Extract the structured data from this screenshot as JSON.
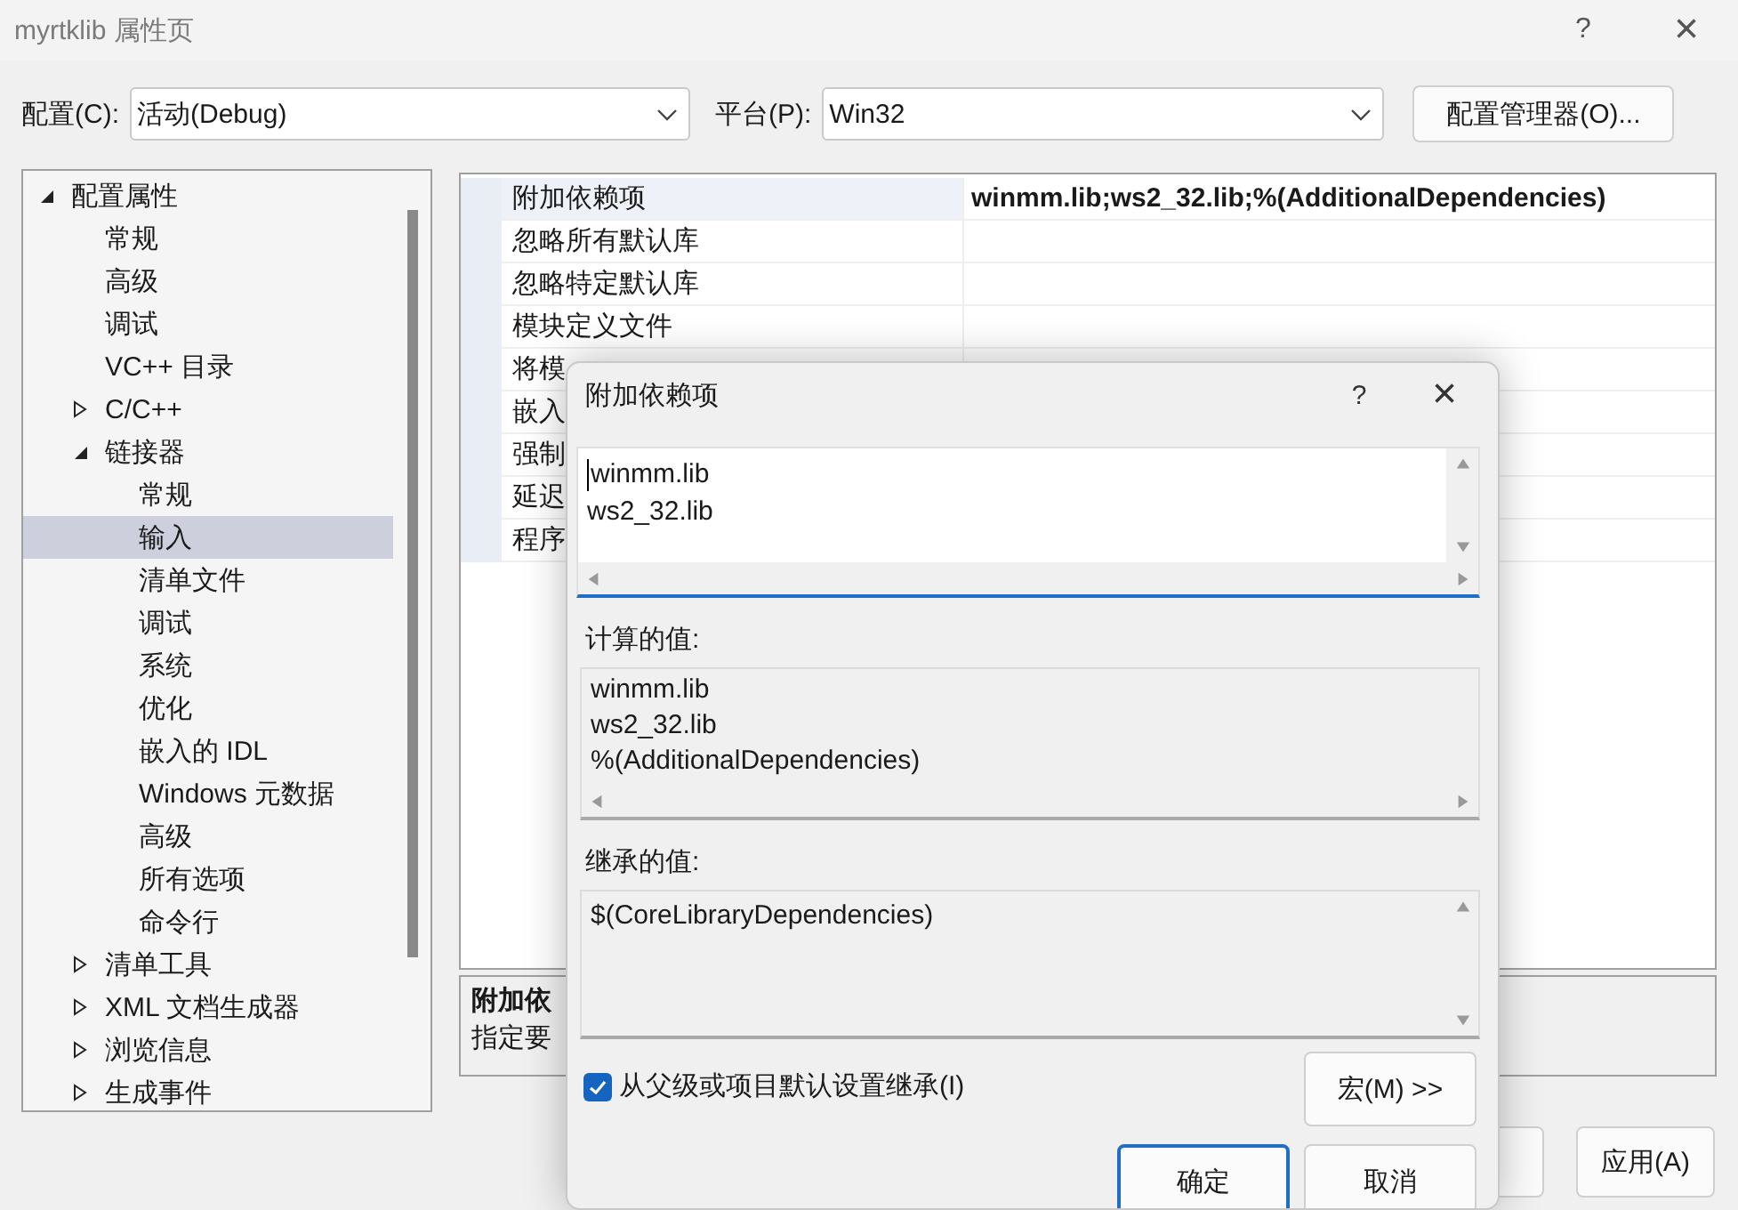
{
  "window": {
    "title": "myrtklib 属性页",
    "help": "?",
    "close": "×"
  },
  "config_bar": {
    "config_label": "配置(C):",
    "config_value": "活动(Debug)",
    "platform_label": "平台(P):",
    "platform_value": "Win32",
    "manager_button": "配置管理器(O)..."
  },
  "tree": [
    {
      "label": "配置属性",
      "expanded": true,
      "selected": false,
      "children": [
        {
          "label": "常规",
          "selected": false
        },
        {
          "label": "高级",
          "selected": false
        },
        {
          "label": "调试",
          "selected": false
        },
        {
          "label": "VC++ 目录",
          "selected": false
        },
        {
          "label": "C/C++",
          "expanded": false,
          "selected": false
        },
        {
          "label": "链接器",
          "expanded": true,
          "selected": false,
          "children": [
            {
              "label": "常规",
              "selected": false
            },
            {
              "label": "输入",
              "selected": true
            },
            {
              "label": "清单文件",
              "selected": false
            },
            {
              "label": "调试",
              "selected": false
            },
            {
              "label": "系统",
              "selected": false
            },
            {
              "label": "优化",
              "selected": false
            },
            {
              "label": "嵌入的 IDL",
              "selected": false
            },
            {
              "label": "Windows 元数据",
              "selected": false
            },
            {
              "label": "高级",
              "selected": false
            },
            {
              "label": "所有选项",
              "selected": false
            },
            {
              "label": "命令行",
              "selected": false
            }
          ]
        },
        {
          "label": "清单工具",
          "expanded": false,
          "selected": false
        },
        {
          "label": "XML 文档生成器",
          "expanded": false,
          "selected": false
        },
        {
          "label": "浏览信息",
          "expanded": false,
          "selected": false
        },
        {
          "label": "生成事件",
          "expanded": false,
          "selected": false
        }
      ]
    }
  ],
  "properties": [
    {
      "name": "附加依赖项",
      "value": "winmm.lib;ws2_32.lib;%(AdditionalDependencies)",
      "modified": true,
      "selected": true
    },
    {
      "name": "忽略所有默认库",
      "selected": false
    },
    {
      "name": "忽略特定默认库",
      "selected": false
    },
    {
      "name": "模块定义文件",
      "selected": false
    },
    {
      "name": "将模",
      "selected": false
    },
    {
      "name": "嵌入",
      "selected": false
    },
    {
      "name": "强制",
      "selected": false
    },
    {
      "name": "延迟",
      "selected": false
    },
    {
      "name": "程序",
      "selected": false
    }
  ],
  "description": {
    "title": "附加依",
    "text": "指定要"
  },
  "bottom_buttons": [
    {
      "label": "应用(A)"
    }
  ],
  "dialog": {
    "title": "附加依赖项",
    "help": "?",
    "close": "×",
    "edit_lines": [
      "winmm.lib",
      "ws2_32.lib"
    ],
    "computed_label": "计算的值:",
    "computed_lines": [
      "winmm.lib",
      "ws2_32.lib",
      "%(AdditionalDependencies)"
    ],
    "inherited_label": "继承的值:",
    "inherited_lines": [
      "$(CoreLibraryDependencies)"
    ],
    "inherit_checkbox": {
      "label": "从父级或项目默认设置继承(I)",
      "checked": true
    },
    "macro_button": "宏(M) >>",
    "ok_button": "确定",
    "cancel_button": "取消"
  }
}
